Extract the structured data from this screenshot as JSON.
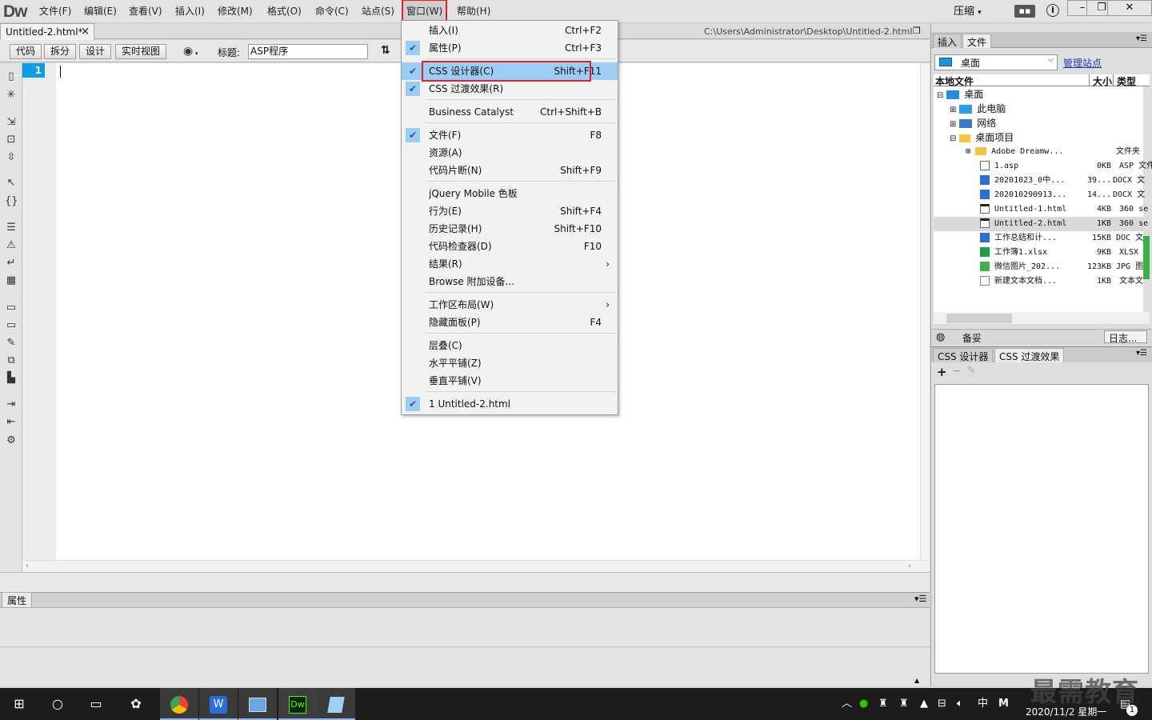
{
  "app": {
    "logo": "Dw"
  },
  "menubar": {
    "items": [
      "文件(F)",
      "编辑(E)",
      "查看(V)",
      "插入(I)",
      "修改(M)",
      "格式(O)",
      "命令(C)",
      "站点(S)",
      "窗口(W)",
      "帮助(H)"
    ],
    "compress": "压缩"
  },
  "document": {
    "tab_title": "Untitled-2.html*",
    "path": "C:\\Users\\Administrator\\Desktop\\Untitled-2.html",
    "line_number": "1"
  },
  "toolbar": {
    "views": [
      "代码",
      "拆分",
      "设计",
      "实时视图"
    ],
    "title_label": "标题:",
    "title_value": "ASP程序"
  },
  "properties": {
    "tab": "属性"
  },
  "window_menu": {
    "items": [
      {
        "label": "插入(I)",
        "shortcut": "Ctrl+F2",
        "checked": false
      },
      {
        "label": "属性(P)",
        "shortcut": "Ctrl+F3",
        "checked": true
      },
      {
        "label": "CSS 设计器(C)",
        "shortcut": "Shift+F11",
        "checked": true,
        "highlight": true
      },
      {
        "label": "CSS 过渡效果(R)",
        "shortcut": "",
        "checked": true
      },
      {
        "label": "Business Catalyst",
        "shortcut": "Ctrl+Shift+B",
        "checked": false
      },
      {
        "label": "文件(F)",
        "shortcut": "F8",
        "checked": true
      },
      {
        "label": "资源(A)",
        "shortcut": "",
        "checked": false
      },
      {
        "label": "代码片断(N)",
        "shortcut": "Shift+F9",
        "checked": false
      },
      {
        "label": "jQuery Mobile 色板",
        "shortcut": "",
        "checked": false
      },
      {
        "label": "行为(E)",
        "shortcut": "Shift+F4",
        "checked": false
      },
      {
        "label": "历史记录(H)",
        "shortcut": "Shift+F10",
        "checked": false
      },
      {
        "label": "代码检查器(D)",
        "shortcut": "F10",
        "checked": false
      },
      {
        "label": "结果(R)",
        "shortcut": "",
        "checked": false,
        "submenu": true
      },
      {
        "label": "Browse 附加设备...",
        "shortcut": "",
        "checked": false
      },
      {
        "label": "工作区布局(W)",
        "shortcut": "",
        "checked": false,
        "submenu": true
      },
      {
        "label": "隐藏面板(P)",
        "shortcut": "F4",
        "checked": false
      },
      {
        "label": "层叠(C)",
        "shortcut": "",
        "checked": false
      },
      {
        "label": "水平平铺(Z)",
        "shortcut": "",
        "checked": false
      },
      {
        "label": "垂直平铺(V)",
        "shortcut": "",
        "checked": false
      },
      {
        "label": "1 Untitled-2.html",
        "shortcut": "",
        "checked": true
      }
    ]
  },
  "files_panel": {
    "tabs": [
      "插入",
      "文件"
    ],
    "site": "桌面",
    "manage_link": "管理站点",
    "columns": [
      "本地文件",
      "大小",
      "类型"
    ],
    "rows": [
      {
        "name": "桌面",
        "size": "",
        "type": ""
      },
      {
        "name": "此电脑",
        "size": "",
        "type": ""
      },
      {
        "name": "网络",
        "size": "",
        "type": ""
      },
      {
        "name": "桌面项目",
        "size": "",
        "type": ""
      },
      {
        "name": "Adobe Dreamw...",
        "size": "",
        "type": "文件夹"
      },
      {
        "name": "1.asp",
        "size": "0KB",
        "type": "ASP 文件"
      },
      {
        "name": "20201023_0中...",
        "size": "39...",
        "type": "DOCX 文"
      },
      {
        "name": "202010290913...",
        "size": "14...",
        "type": "DOCX 文"
      },
      {
        "name": "Untitled-1.html",
        "size": "4KB",
        "type": "360 se"
      },
      {
        "name": "Untitled-2.html",
        "size": "1KB",
        "type": "360 se"
      },
      {
        "name": "工作总结和计...",
        "size": "15KB",
        "type": "DOC 文"
      },
      {
        "name": "工作簿1.xlsx",
        "size": "9KB",
        "type": "XLSX"
      },
      {
        "name": "微信图片_202...",
        "size": "123KB",
        "type": "JPG 图"
      },
      {
        "name": "新建文本文档...",
        "size": "1KB",
        "type": "文本文"
      }
    ],
    "status": "备妥",
    "log_button": "日志..."
  },
  "css_panel": {
    "tabs": [
      "CSS 设计器",
      "CSS 过渡效果"
    ]
  },
  "taskbar": {
    "date": "2020/11/2 星期一",
    "ime": "中",
    "notif_count": "1"
  },
  "watermark": "最需教育"
}
